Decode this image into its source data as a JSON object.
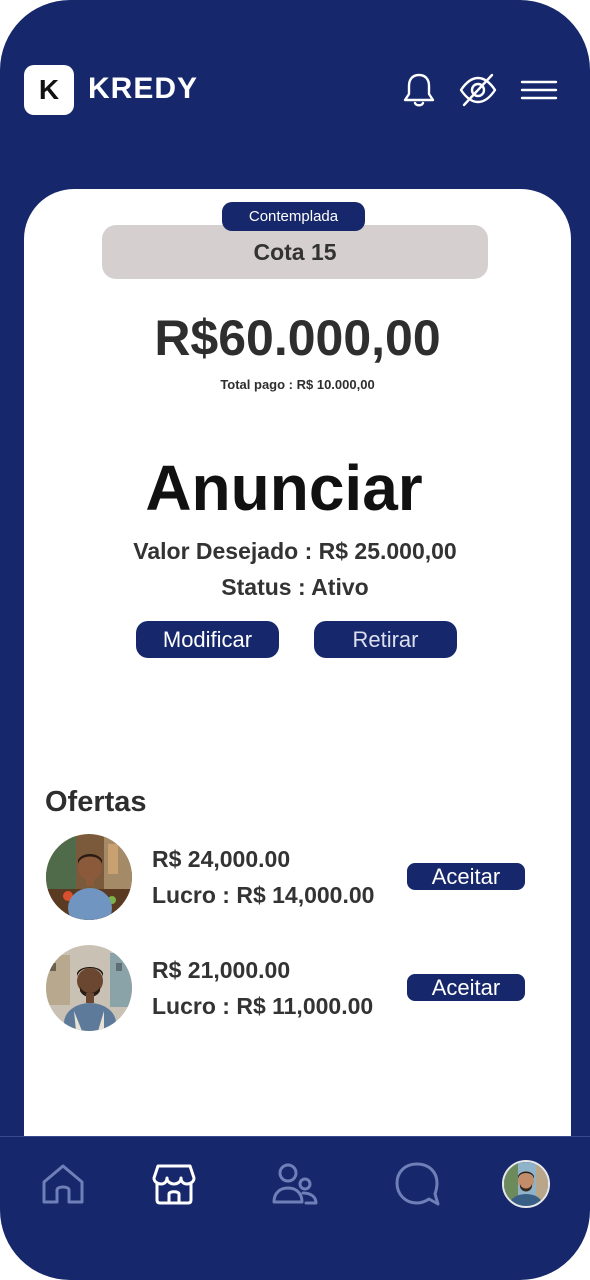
{
  "header": {
    "logo_letter": "K",
    "brand": "KREDY"
  },
  "card": {
    "status_badge": "Contemplada",
    "quota": "Cota 15",
    "amount": "R$60.000,00",
    "total_pago": "Total pago : R$ 10.000,00",
    "anunciar_title": "Anunciar",
    "valor_desejado": "Valor Desejado : R$ 25.000,00",
    "status": "Status : Ativo",
    "modify_label": "Modificar",
    "withdraw_label": "Retirar"
  },
  "offers": {
    "title": "Ofertas",
    "items": [
      {
        "value": "R$ 24,000.00",
        "lucro": "Lucro : R$ 14,000.00",
        "accept_label": "Aceitar"
      },
      {
        "value": "R$ 21,000.00",
        "lucro": "Lucro : R$ 11,000.00",
        "accept_label": "Aceitar"
      }
    ]
  },
  "icons": {
    "header": [
      "bell-icon",
      "eye-off-icon",
      "menu-icon"
    ],
    "nav": [
      "home-icon",
      "store-icon",
      "users-icon",
      "chat-icon",
      "profile-avatar"
    ]
  },
  "colors": {
    "brand_navy": "#16276b",
    "card_bg": "#ffffff",
    "quota_pill": "#d6cfcf",
    "nav_icon_inactive": "#6f7fb8",
    "nav_icon_active": "#ffffff"
  }
}
